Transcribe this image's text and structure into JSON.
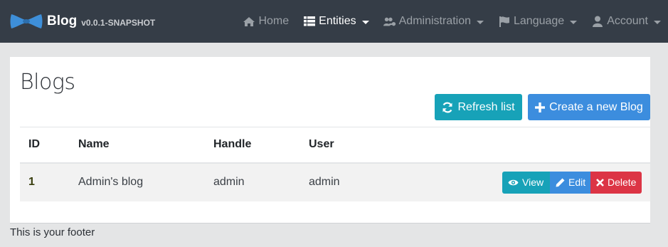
{
  "brand": {
    "name": "Blog",
    "version": "v0.0.1-SNAPSHOT"
  },
  "nav": {
    "items": [
      {
        "label": "Home",
        "icon": "home-icon"
      },
      {
        "label": "Entities",
        "icon": "list-icon"
      },
      {
        "label": "Administration",
        "icon": "users-cog-icon"
      },
      {
        "label": "Language",
        "icon": "flag-icon"
      },
      {
        "label": "Account",
        "icon": "user-icon"
      }
    ]
  },
  "page": {
    "title": "Blogs",
    "refresh_label": "Refresh list",
    "create_label": "Create a new Blog"
  },
  "table": {
    "headers": [
      "ID",
      "Name",
      "Handle",
      "User"
    ],
    "rows": [
      {
        "id": "1",
        "name": "Admin's blog",
        "handle": "admin",
        "user": "admin"
      }
    ],
    "actions": {
      "view": "View",
      "edit": "Edit",
      "delete": "Delete"
    }
  },
  "footer": {
    "text": "This is your footer"
  },
  "colors": {
    "navbar": "#353d47",
    "info": "#17a2b8",
    "primary": "#3c8dde",
    "danger": "#dc3545"
  }
}
